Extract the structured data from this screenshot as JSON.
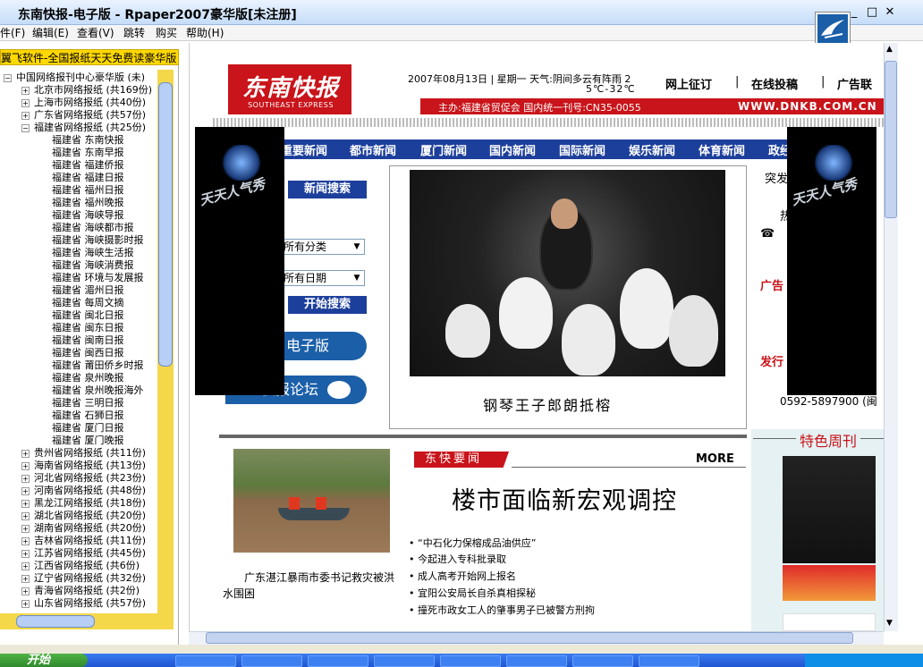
{
  "window": {
    "title": "东南快报-电子版 - Rpaper2007豪华版[未注册]",
    "min_label": "_",
    "max_label": "□",
    "close_label": "✕"
  },
  "menu": [
    "件(F)",
    "编辑(E)",
    "查看(V)",
    "跳转",
    "购买",
    "帮助(H)"
  ],
  "sidebar": {
    "ad_text": "翼飞软件-全国报纸天天免费读豪华版",
    "root_label": "中国网络报刊中心豪华版 (未)",
    "provinces_top": [
      "北京市网络报纸 (共169份)",
      "上海市网络报纸 (共40份)",
      "广东省网络报纸 (共57份)",
      "福建省网络报纸 (共25份)"
    ],
    "fujian_papers": [
      "福建省 东南快报",
      "福建省 东南早报",
      "福建省 福建侨报",
      "福建省 福建日报",
      "福建省 福州日报",
      "福建省 福州晚报",
      "福建省 海峡导报",
      "福建省 海峡都市报",
      "福建省 海峡摄影时报",
      "福建省 海峡生活报",
      "福建省 海峡消费报",
      "福建省 环境与发展报",
      "福建省 湄州日报",
      "福建省 每周文摘",
      "福建省 闽北日报",
      "福建省 闽东日报",
      "福建省 闽南日报",
      "福建省 闽西日报",
      "福建省 莆田侨乡时报",
      "福建省 泉州晚报",
      "福建省 泉州晚报海外",
      "福建省 三明日报",
      "福建省 石狮日报",
      "福建省 厦门日报",
      "福建省 厦门晚报"
    ],
    "provinces_bottom": [
      "贵州省网络报纸 (共11份)",
      "海南省网络报纸 (共13份)",
      "河北省网络报纸 (共23份)",
      "河南省网络报纸 (共48份)",
      "黑龙江网络报纸 (共18份)",
      "湖北省网络报纸 (共20份)",
      "湖南省网络报纸 (共20份)",
      "吉林省网络报纸 (共11份)",
      "江苏省网络报纸 (共45份)",
      "江西省网络报纸 (共6份)",
      "辽宁省网络报纸 (共32份)",
      "青海省网络报纸 (共2份)",
      "山东省网络报纸 (共57份)"
    ]
  },
  "page": {
    "masthead_cn": "东南快报",
    "masthead_en": "SOUTHEAST EXPRESS",
    "dateline": "2007年08月13日 | 星期一  天气:阴间多云有阵雨 2",
    "temperature": "5℃-32℃",
    "top_links": [
      "网上征订",
      "在线投稿",
      "广告联"
    ],
    "redbar_text": "主办:福建省贸促会  国内统一刊号:CN35-0055",
    "redbar_url": "WWW.DNKB.COM.CN",
    "nav": [
      "重要新闻",
      "都市新闻",
      "厦门新闻",
      "国内新闻",
      "国际新闻",
      "娱乐新闻",
      "体育新闻",
      "政经"
    ],
    "search_title": "新闻搜索",
    "select_category": "所有分类",
    "select_date": "所有日期",
    "search_button": "开始搜索",
    "epaper_label": "电子版",
    "forum_label": "快报论坛",
    "photo_caption": "钢琴王子郎朗抵榕",
    "right_col": {
      "line1": "突发",
      "line2": "热",
      "ad_label": "广告",
      "fa_label": "发行",
      "phone": "0592-5897900 (闽"
    },
    "flood_caption": "广东湛江暴雨市委书记救灾被洪水围困",
    "kuai_tag": "东快要闻",
    "more": "MORE",
    "headline": "楼市面临新宏观调控",
    "bullets": [
      "“中石化力保榕成品油供应”",
      "今起进入专科批录取",
      "成人高考开始网上报名",
      "宜阳公安局长自杀真相探秘",
      "撞死市政女工人的肇事男子已被警方刑拘"
    ],
    "weekly_title": "特色周刊",
    "banner_text": "天天人气秀"
  },
  "taskbar": {
    "start_label": "开始"
  }
}
